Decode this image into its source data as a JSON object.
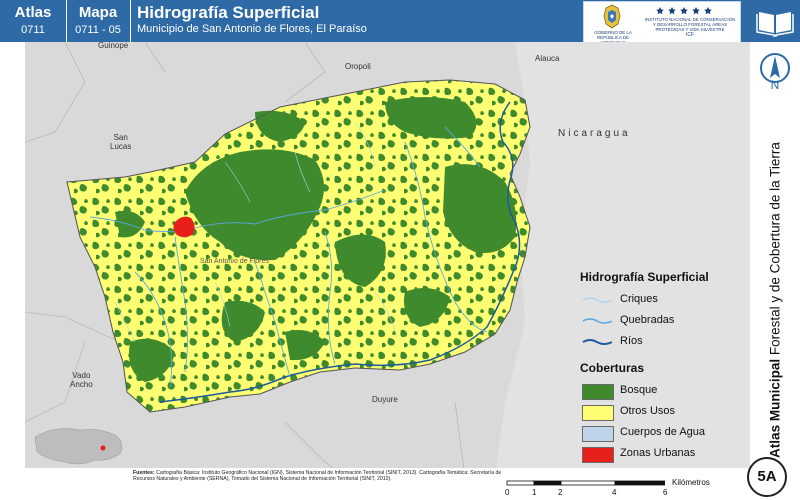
{
  "header": {
    "atlas_label": "Atlas",
    "atlas_code": "0711",
    "mapa_label": "Mapa",
    "mapa_code": "0711 - 05",
    "title": "Hidrografía Superficial",
    "subtitle": "Municipio de San Antonio de Flores, El Paraíso",
    "logo_left_text": "GOBIERNO DE LA REPÚBLICA DE HONDURAS",
    "logo_right_text": "INSTITUTO NACIONAL DE CONSERVACIÓN Y DESARROLLO FORESTAL ÁREAS PROTEGIDAS Y VIDA SILVESTRE",
    "logo_right_abbr": "ICF",
    "book_icon": "open-book-icon"
  },
  "sidebar": {
    "north_label": "N",
    "north_icon": "north-arrow-icon",
    "vertical_title_bold": "Atlas Municipal",
    "vertical_title_rest": " Forestal y de Cobertura de la Tierra",
    "badge": "5A"
  },
  "map_labels": {
    "guinope": "Guinope",
    "oropoli": "Oropoli",
    "alauca": "Alauca",
    "nicaragua": "Nicaragua",
    "san_lucas": "San\nLucas",
    "vado_ancho": "Vado\nAncho",
    "duyure": "Duyure",
    "municipio": "San Antonio de Flores"
  },
  "legend": {
    "hidro_title": "Hidrografía Superficial",
    "hidro_items": [
      {
        "label": "Criques",
        "color": "#a8d0f0"
      },
      {
        "label": "Quebradas",
        "color": "#5aa8e0"
      },
      {
        "label": "Ríos",
        "color": "#1e5aa0"
      }
    ],
    "cob_title": "Coberturas",
    "cob_items": [
      {
        "label": "Bosque",
        "color": "#3f8a2c"
      },
      {
        "label": "Otros Usos",
        "color": "#ffff73"
      },
      {
        "label": "Cuerpos de Agua",
        "color": "#bed2e8"
      },
      {
        "label": "Zonas Urbanas",
        "color": "#e8201c"
      }
    ]
  },
  "footer": {
    "fuentes_label": "Fuentes:",
    "fuentes_text": "Cartografía Básica: Instituto Geográfico Nacional (IGN), Sistema Nacional de Información Territorial (SINIT, 2013). Cartografía Temática: Secretaría de Recursos Naturales y Ambiente (SERNA), Tomado del Sistema Nacional de Información Territorial (SINIT, 2010).",
    "scale_ticks": [
      "0",
      "1",
      "2",
      "4",
      "6"
    ],
    "scale_unit": "Kilómetros"
  },
  "colors": {
    "header_blue": "#2d6aa6",
    "forest": "#3f8a2c",
    "other_uses": "#ffff73",
    "urban": "#e8201c",
    "background": "#d9d9d9"
  }
}
